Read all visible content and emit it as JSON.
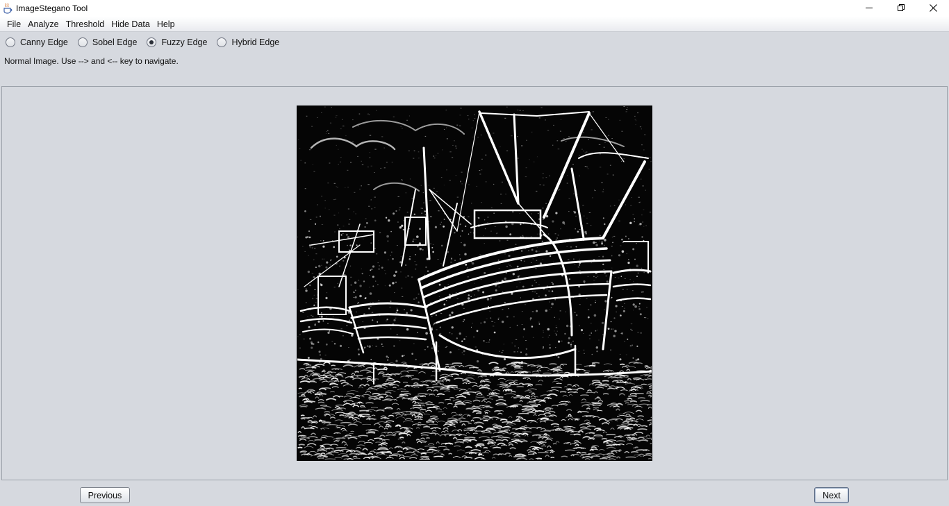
{
  "window": {
    "title": "ImageStegano Tool",
    "app_icon": "java-cup-icon",
    "controls": [
      "minimize-icon",
      "restore-icon",
      "close-icon"
    ]
  },
  "menubar": {
    "items": [
      {
        "label": "File"
      },
      {
        "label": "Analyze"
      },
      {
        "label": "Threshold"
      },
      {
        "label": "Hide Data"
      },
      {
        "label": "Help"
      }
    ]
  },
  "edge_options": {
    "options": [
      {
        "label": "Canny Edge",
        "checked": false
      },
      {
        "label": "Sobel Edge",
        "checked": false
      },
      {
        "label": "Fuzzy Edge",
        "checked": true
      },
      {
        "label": "Hybrid Edge",
        "checked": false
      }
    ],
    "selected": "Fuzzy Edge"
  },
  "status": {
    "text": "Normal Image. Use --> and <-- key to navigate."
  },
  "image": {
    "subject": "edge-detected-boats-image",
    "background_color": "#050505",
    "edge_color": "#ffffff"
  },
  "buttons": {
    "previous_label": "Previous",
    "next_label": "Next"
  }
}
